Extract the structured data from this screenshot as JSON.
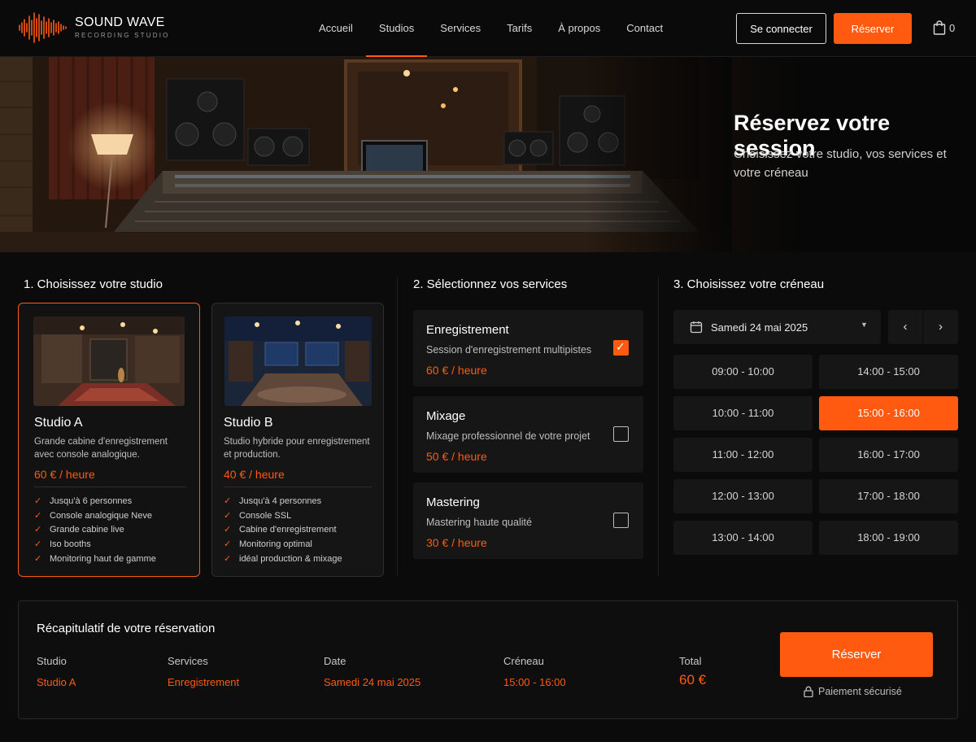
{
  "brand": {
    "name": "SOUND WAVE",
    "subtitle": "RECORDING STUDIO",
    "accent": "#ff5a10"
  },
  "nav": {
    "links": [
      "Accueil",
      "Studios",
      "Services",
      "Tarifs",
      "À propos",
      "Contact"
    ],
    "active": "Studios",
    "login_label": "Se connecter",
    "reserve_label": "Réserver",
    "cart_count": "0"
  },
  "hero": {
    "title": "Réservez votre session",
    "subtitle": "Choisissez votre studio, vos services et votre créneau"
  },
  "step1": {
    "title": "1. Choisissez votre studio",
    "studios": [
      {
        "name": "Studio A",
        "description": "Grande cabine d'enregistrement avec console analogique.",
        "price": "60 € / heure",
        "selected": true,
        "features": [
          "Jusqu'à 6 personnes",
          "Console analogique Neve",
          "Grande cabine live",
          "Iso booths",
          "Monitoring haut de gamme"
        ]
      },
      {
        "name": "Studio B",
        "description": "Studio hybride pour enregistrement et production.",
        "price": "40 € / heure",
        "selected": false,
        "features": [
          "Jusqu'à 4 personnes",
          "Console SSL",
          "Cabine d'enregistrement",
          "Monitoring optimal",
          "idéal production & mixage"
        ]
      }
    ]
  },
  "step2": {
    "title": "2. Sélectionnez vos services",
    "services": [
      {
        "name": "Enregistrement",
        "description": "Session d'enregistrement multipistes",
        "price": "60 € / heure",
        "checked": true
      },
      {
        "name": "Mixage",
        "description": "Mixage professionnel de votre projet",
        "price": "50 € / heure",
        "checked": false
      },
      {
        "name": "Mastering",
        "description": "Mastering haute qualité",
        "price": "30 € / heure",
        "checked": false
      }
    ]
  },
  "step3": {
    "title": "3. Choisissez votre créneau",
    "date": "Samedi 24 mai 2025",
    "slots_left": [
      "09:00 - 10:00",
      "10:00 - 11:00",
      "11:00 - 12:00",
      "12:00 - 13:00",
      "13:00 - 14:00"
    ],
    "slots_right": [
      "14:00 - 15:00",
      "15:00 - 16:00",
      "16:00 - 17:00",
      "17:00 - 18:00",
      "18:00 - 19:00"
    ],
    "selected_slot": "15:00 - 16:00"
  },
  "summary": {
    "title": "Récapitulatif de votre réservation",
    "studio_label": "Studio",
    "studio_value": "Studio A",
    "services_label": "Services",
    "services_value": "Enregistrement",
    "date_label": "Date",
    "date_value": "Samedi 24 mai 2025",
    "slot_label": "Créneau",
    "slot_value": "15:00 - 16:00",
    "total_label": "Total",
    "total_value": "60 €",
    "reserve_label": "Réserver",
    "secure_label": "Paiement sécurisé"
  }
}
